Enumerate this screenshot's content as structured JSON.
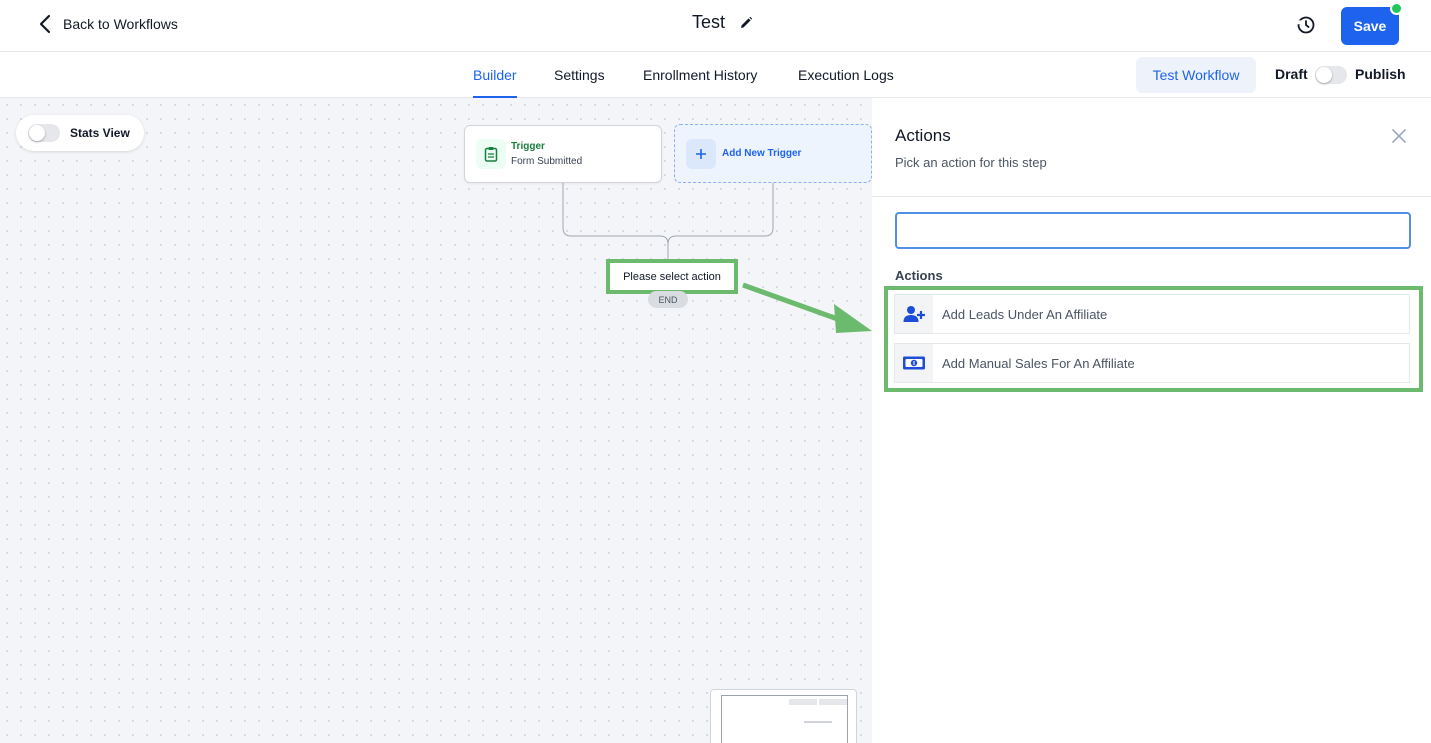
{
  "header": {
    "back_label": "Back to Workflows",
    "workflow_title": "Test",
    "save_label": "Save"
  },
  "tabs": [
    {
      "label": "Builder",
      "active": true
    },
    {
      "label": "Settings",
      "active": false
    },
    {
      "label": "Enrollment History",
      "active": false
    },
    {
      "label": "Execution Logs",
      "active": false
    }
  ],
  "toolbar": {
    "test_workflow_label": "Test Workflow",
    "draft_label": "Draft",
    "publish_label": "Publish",
    "publish_enabled": false
  },
  "canvas": {
    "stats_view_label": "Stats View",
    "stats_view_enabled": false,
    "trigger": {
      "type_label": "Trigger",
      "name": "Form Submitted",
      "icon": "clipboard-icon"
    },
    "add_trigger_label": "Add New Trigger",
    "select_action_label": "Please select action",
    "end_label": "END"
  },
  "panel": {
    "title": "Actions",
    "subtitle": "Pick an action for this step",
    "search_value": "",
    "search_placeholder": "",
    "section_label": "Actions",
    "actions": [
      {
        "label": "Add Leads Under An Affiliate",
        "icon": "user-plus-icon"
      },
      {
        "label": "Add Manual Sales For An Affiliate",
        "icon": "money-bill-icon"
      }
    ]
  },
  "colors": {
    "accent": "#1d63ed",
    "highlight": "#6cba6d",
    "trigger_green": "#16803c",
    "online_dot": "#22c55e"
  }
}
